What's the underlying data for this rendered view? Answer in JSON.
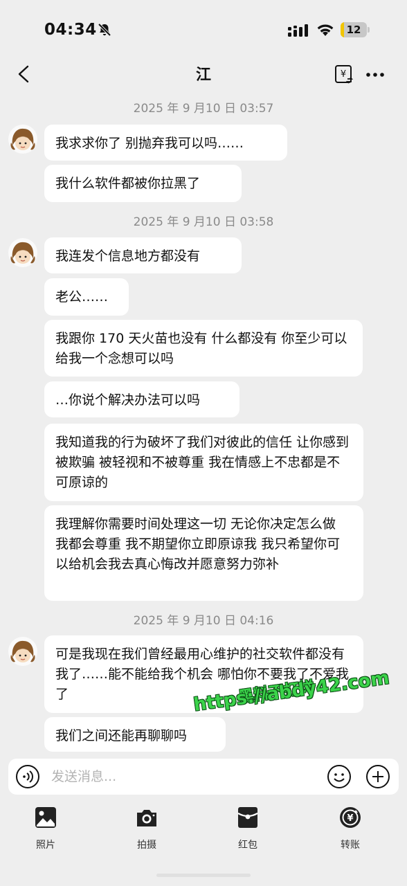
{
  "status_bar": {
    "time": "04:34",
    "battery": "12",
    "battery_level": 0.12
  },
  "header": {
    "title": "江"
  },
  "messages": [
    {
      "timestamp": "2025 年 9 月10 日 03:57"
    },
    {
      "text": "我求求你了 别抛弃我可以吗……"
    },
    {
      "text": "我什么软件都被你拉黑了"
    },
    {
      "timestamp": "2025 年 9 月10 日 03:58"
    },
    {
      "text": "我连发个信息地方都没有"
    },
    {
      "text": "老公……"
    },
    {
      "text": "我跟你 170 天火苗也没有 什么都没有 你至少可以给我一个念想可以吗"
    },
    {
      "text": "…你说个解决办法可以吗"
    },
    {
      "text": "我知道我的行为破坏了我们对彼此的信任 让你感到被欺骗 被轻视和不被尊重 我在情感上不忠都是不可原谅的"
    },
    {
      "text": "我理解你需要时间处理这一切 无论你决定怎么做 我都会尊重 我不期望你立即原谅我 我只希望你可以给机会我去真心悔改并愿意努力弥补"
    },
    {
      "timestamp": "2025 年 9 月10 日 04:16"
    },
    {
      "text": "可是我现在我们曾经最用心维护的社交软件都没有我了……能不能给我个机会 哪怕你不要我了不爱我了"
    },
    {
      "text": "我们之间还能再聊聊吗"
    }
  ],
  "watermark": {
    "line1": "黑料不打烊",
    "line2": "https://abdy42.com"
  },
  "input": {
    "placeholder": "发送消息..."
  },
  "toolbar": [
    {
      "label": "照片",
      "icon": "photo-icon"
    },
    {
      "label": "拍摄",
      "icon": "camera-icon"
    },
    {
      "label": "红包",
      "icon": "red-packet-icon"
    },
    {
      "label": "转账",
      "icon": "transfer-icon"
    }
  ]
}
